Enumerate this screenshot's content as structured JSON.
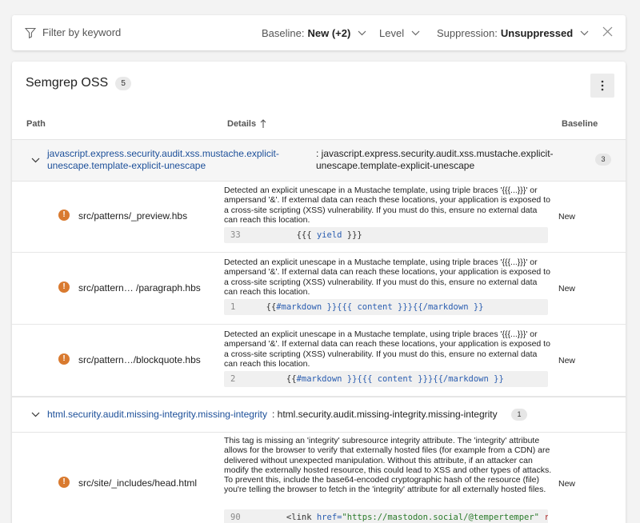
{
  "filter_bar": {
    "keyword_placeholder": "Filter by keyword",
    "baseline_label": "Baseline:",
    "baseline_value": "New (+2)",
    "level_label": "Level",
    "suppression_label": "Suppression:",
    "suppression_value": "Unsuppressed"
  },
  "card": {
    "title": "Semgrep OSS",
    "count": "5"
  },
  "columns": {
    "path": "Path",
    "details": "Details",
    "baseline": "Baseline"
  },
  "groups": [
    {
      "rule_id_line1": "javascript.express.security.audit.xss.mustache.explicit-",
      "rule_id_line2": "unescape.template-explicit-unescape",
      "desc_line1": ": javascript.express.security.audit.xss.mustache.explicit-",
      "desc_line2": "unescape.template-explicit-unescape",
      "count": "3"
    },
    {
      "rule_id": "html.security.audit.missing-integrity.missing-integrity",
      "desc": ": html.security.audit.missing-integrity.missing-integrity",
      "count": "1"
    }
  ],
  "findings": [
    {
      "path": "src/patterns/_preview.hbs",
      "desc": "Detected an explicit unescape in a Mustache template, using triple braces '{{{...}}}' or ampersand '&'. If external data can reach these locations, your application is exposed to a cross-site scripting (XSS) vulnerability. If you must do this, ensure no external data can reach this location.",
      "line": "33",
      "code_pre": "        {{{ ",
      "code_kw": "yield",
      "code_post": " }}}",
      "baseline": "New"
    },
    {
      "path": "src/pattern… /paragraph.hbs",
      "desc": "Detected an explicit unescape in a Mustache template, using triple braces '{{{...}}}' or ampersand '&'. If external data can reach these locations, your application is exposed to a cross-site scripting (XSS) vulnerability. If you must do this, ensure no external data can reach this location.",
      "line": "1",
      "code_pre": "  {{",
      "code_kw": "#markdown }}{{{ content }}}{{/markdown }}",
      "code_post": "",
      "baseline": "New"
    },
    {
      "path": "src/pattern…/blockquote.hbs",
      "desc": "Detected an explicit unescape in a Mustache template, using triple braces '{{{...}}}' or ampersand '&'. If external data can reach these locations, your application is exposed to a cross-site scripting (XSS) vulnerability. If you must do this, ensure no external data can reach this location.",
      "line": "2",
      "code_pre": "      {{",
      "code_kw": "#markdown }}{{{ content }}}{{/markdown }}",
      "code_post": "",
      "baseline": "New"
    },
    {
      "path": "src/site/_includes/head.html",
      "desc": "This tag is missing an 'integrity' subresource integrity attribute. The 'integrity' attribute allows for the browser to verify that externally hosted files (for example from a CDN) are delivered without unexpected manipulation. Without this attribute, if an attacker can modify the externally hosted resource, this could lead to XSS and other types of attacks. To prevent this, include the base64-encoded cryptographic hash of the resource (file) you're telling the browser to fetch in the 'integrity' attribute for all externally hosted files.",
      "line": "90",
      "code_pre": "      <link ",
      "code_kw": "href=",
      "code_str": "\"https://mastodon.social/@tempertemper\"",
      "code_post": " re",
      "baseline": "New"
    }
  ]
}
